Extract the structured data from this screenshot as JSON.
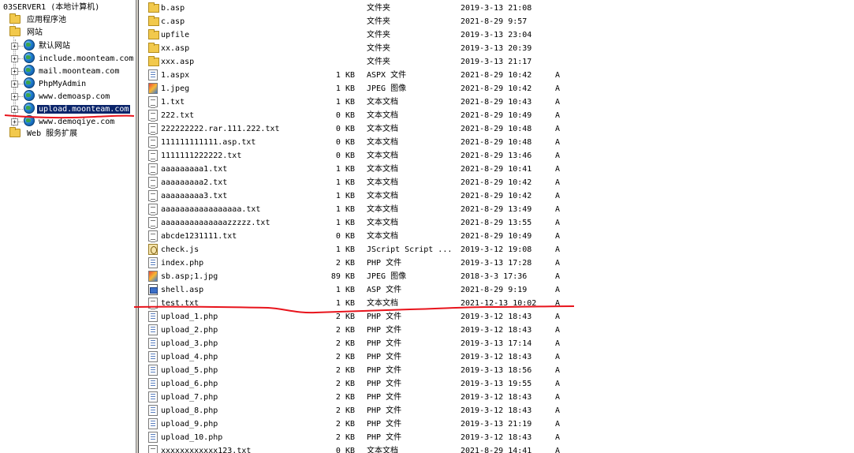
{
  "tree": {
    "root": "03SERVER1 (本地计算机)",
    "app_pools": "应用程序池",
    "websites": "网站",
    "sites": [
      "默认网站",
      "include.moonteam.com",
      "mail.moonteam.com",
      "PhpMyAdmin",
      "www.demoasp.com",
      "upload.moonteam.com",
      "www.demoqiye.com"
    ],
    "web_ext": "Web 服务扩展",
    "selected_index": 5
  },
  "files": [
    {
      "icon": "folder",
      "name": "b.asp",
      "size": "",
      "unit": "",
      "type": "文件夹",
      "date": "2019-3-13 21:08",
      "attr": ""
    },
    {
      "icon": "folder",
      "name": "c.asp",
      "size": "",
      "unit": "",
      "type": "文件夹",
      "date": "2021-8-29 9:57",
      "attr": ""
    },
    {
      "icon": "folder",
      "name": "upfile",
      "size": "",
      "unit": "",
      "type": "文件夹",
      "date": "2019-3-13 23:04",
      "attr": ""
    },
    {
      "icon": "folder",
      "name": "xx.asp",
      "size": "",
      "unit": "",
      "type": "文件夹",
      "date": "2019-3-13 20:39",
      "attr": ""
    },
    {
      "icon": "folder",
      "name": "xxx.asp",
      "size": "",
      "unit": "",
      "type": "文件夹",
      "date": "2019-3-13 21:17",
      "attr": ""
    },
    {
      "icon": "aspx",
      "name": "1.aspx",
      "size": "1",
      "unit": "KB",
      "type": "ASPX 文件",
      "date": "2021-8-29 10:42",
      "attr": "A"
    },
    {
      "icon": "img",
      "name": "1.jpeg",
      "size": "1",
      "unit": "KB",
      "type": "JPEG 图像",
      "date": "2021-8-29 10:42",
      "attr": "A"
    },
    {
      "icon": "txt",
      "name": "1.txt",
      "size": "1",
      "unit": "KB",
      "type": "文本文档",
      "date": "2021-8-29 10:43",
      "attr": "A"
    },
    {
      "icon": "txt",
      "name": "222.txt",
      "size": "0",
      "unit": "KB",
      "type": "文本文档",
      "date": "2021-8-29 10:49",
      "attr": "A"
    },
    {
      "icon": "txt",
      "name": "222222222.rar.111.222.txt",
      "size": "0",
      "unit": "KB",
      "type": "文本文档",
      "date": "2021-8-29 10:48",
      "attr": "A"
    },
    {
      "icon": "txt",
      "name": "111111111111.asp.txt",
      "size": "0",
      "unit": "KB",
      "type": "文本文档",
      "date": "2021-8-29 10:48",
      "attr": "A"
    },
    {
      "icon": "txt",
      "name": "1111111222222.txt",
      "size": "0",
      "unit": "KB",
      "type": "文本文档",
      "date": "2021-8-29 13:46",
      "attr": "A"
    },
    {
      "icon": "txt",
      "name": "aaaaaaaaa1.txt",
      "size": "1",
      "unit": "KB",
      "type": "文本文档",
      "date": "2021-8-29 10:41",
      "attr": "A"
    },
    {
      "icon": "txt",
      "name": "aaaaaaaaa2.txt",
      "size": "1",
      "unit": "KB",
      "type": "文本文档",
      "date": "2021-8-29 10:42",
      "attr": "A"
    },
    {
      "icon": "txt",
      "name": "aaaaaaaaa3.txt",
      "size": "1",
      "unit": "KB",
      "type": "文本文档",
      "date": "2021-8-29 10:42",
      "attr": "A"
    },
    {
      "icon": "txt",
      "name": "aaaaaaaaaaaaaaaaa.txt",
      "size": "1",
      "unit": "KB",
      "type": "文本文档",
      "date": "2021-8-29 13:49",
      "attr": "A"
    },
    {
      "icon": "txt",
      "name": "aaaaaaaaaaaaaazzzzz.txt",
      "size": "1",
      "unit": "KB",
      "type": "文本文档",
      "date": "2021-8-29 13:55",
      "attr": "A"
    },
    {
      "icon": "txt",
      "name": "abcde1231111.txt",
      "size": "0",
      "unit": "KB",
      "type": "文本文档",
      "date": "2021-8-29 10:49",
      "attr": "A"
    },
    {
      "icon": "js",
      "name": "check.js",
      "size": "1",
      "unit": "KB",
      "type": "JScript Script ...",
      "date": "2019-3-12 19:08",
      "attr": "A"
    },
    {
      "icon": "php",
      "name": "index.php",
      "size": "2",
      "unit": "KB",
      "type": "PHP 文件",
      "date": "2019-3-13 17:28",
      "attr": "A"
    },
    {
      "icon": "img",
      "name": "sb.asp;1.jpg",
      "size": "89",
      "unit": "KB",
      "type": "JPEG 图像",
      "date": "2018-3-3 17:36",
      "attr": "A"
    },
    {
      "icon": "asp",
      "name": "shell.asp",
      "size": "1",
      "unit": "KB",
      "type": "ASP 文件",
      "date": "2021-8-29 9:19",
      "attr": "A"
    },
    {
      "icon": "txt",
      "name": "test.txt",
      "size": "1",
      "unit": "KB",
      "type": "文本文档",
      "date": "2021-12-13 10:02",
      "attr": "A"
    },
    {
      "icon": "php",
      "name": "upload_1.php",
      "size": "2",
      "unit": "KB",
      "type": "PHP 文件",
      "date": "2019-3-12 18:43",
      "attr": "A"
    },
    {
      "icon": "php",
      "name": "upload_2.php",
      "size": "2",
      "unit": "KB",
      "type": "PHP 文件",
      "date": "2019-3-12 18:43",
      "attr": "A"
    },
    {
      "icon": "php",
      "name": "upload_3.php",
      "size": "2",
      "unit": "KB",
      "type": "PHP 文件",
      "date": "2019-3-13 17:14",
      "attr": "A"
    },
    {
      "icon": "php",
      "name": "upload_4.php",
      "size": "2",
      "unit": "KB",
      "type": "PHP 文件",
      "date": "2019-3-12 18:43",
      "attr": "A"
    },
    {
      "icon": "php",
      "name": "upload_5.php",
      "size": "2",
      "unit": "KB",
      "type": "PHP 文件",
      "date": "2019-3-13 18:56",
      "attr": "A"
    },
    {
      "icon": "php",
      "name": "upload_6.php",
      "size": "2",
      "unit": "KB",
      "type": "PHP 文件",
      "date": "2019-3-13 19:55",
      "attr": "A"
    },
    {
      "icon": "php",
      "name": "upload_7.php",
      "size": "2",
      "unit": "KB",
      "type": "PHP 文件",
      "date": "2019-3-12 18:43",
      "attr": "A"
    },
    {
      "icon": "php",
      "name": "upload_8.php",
      "size": "2",
      "unit": "KB",
      "type": "PHP 文件",
      "date": "2019-3-12 18:43",
      "attr": "A"
    },
    {
      "icon": "php",
      "name": "upload_9.php",
      "size": "2",
      "unit": "KB",
      "type": "PHP 文件",
      "date": "2019-3-13 21:19",
      "attr": "A"
    },
    {
      "icon": "php",
      "name": "upload_10.php",
      "size": "2",
      "unit": "KB",
      "type": "PHP 文件",
      "date": "2019-3-12 18:43",
      "attr": "A"
    },
    {
      "icon": "txt",
      "name": "xxxxxxxxxxxx123.txt",
      "size": "0",
      "unit": "KB",
      "type": "文本文档",
      "date": "2021-8-29 14:41",
      "attr": "A"
    }
  ],
  "annotation_color": "#e8141c"
}
